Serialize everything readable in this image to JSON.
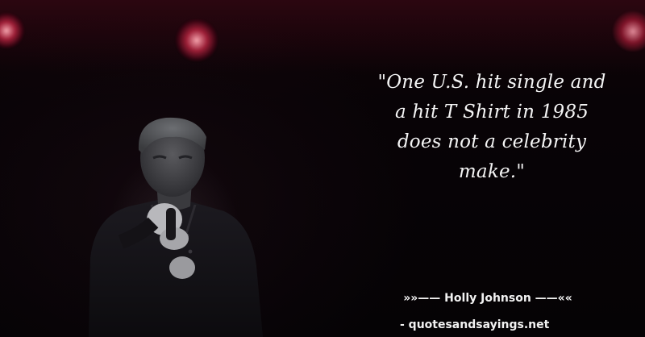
{
  "quote": {
    "lines": [
      "\"One U.S. hit single and",
      "a hit T Shirt in 1985",
      "does not a celebrity",
      "make.\""
    ]
  },
  "attribution": {
    "text": "»»—— Holly Johnson ——««"
  },
  "source": {
    "text": "- quotesandsayings.net"
  },
  "colors": {
    "background": "#050305",
    "text": "#f4f4f4",
    "stage_light": "#c8284a"
  },
  "image": {
    "subject": "performer-photo",
    "icon": "stage-light-icon"
  }
}
